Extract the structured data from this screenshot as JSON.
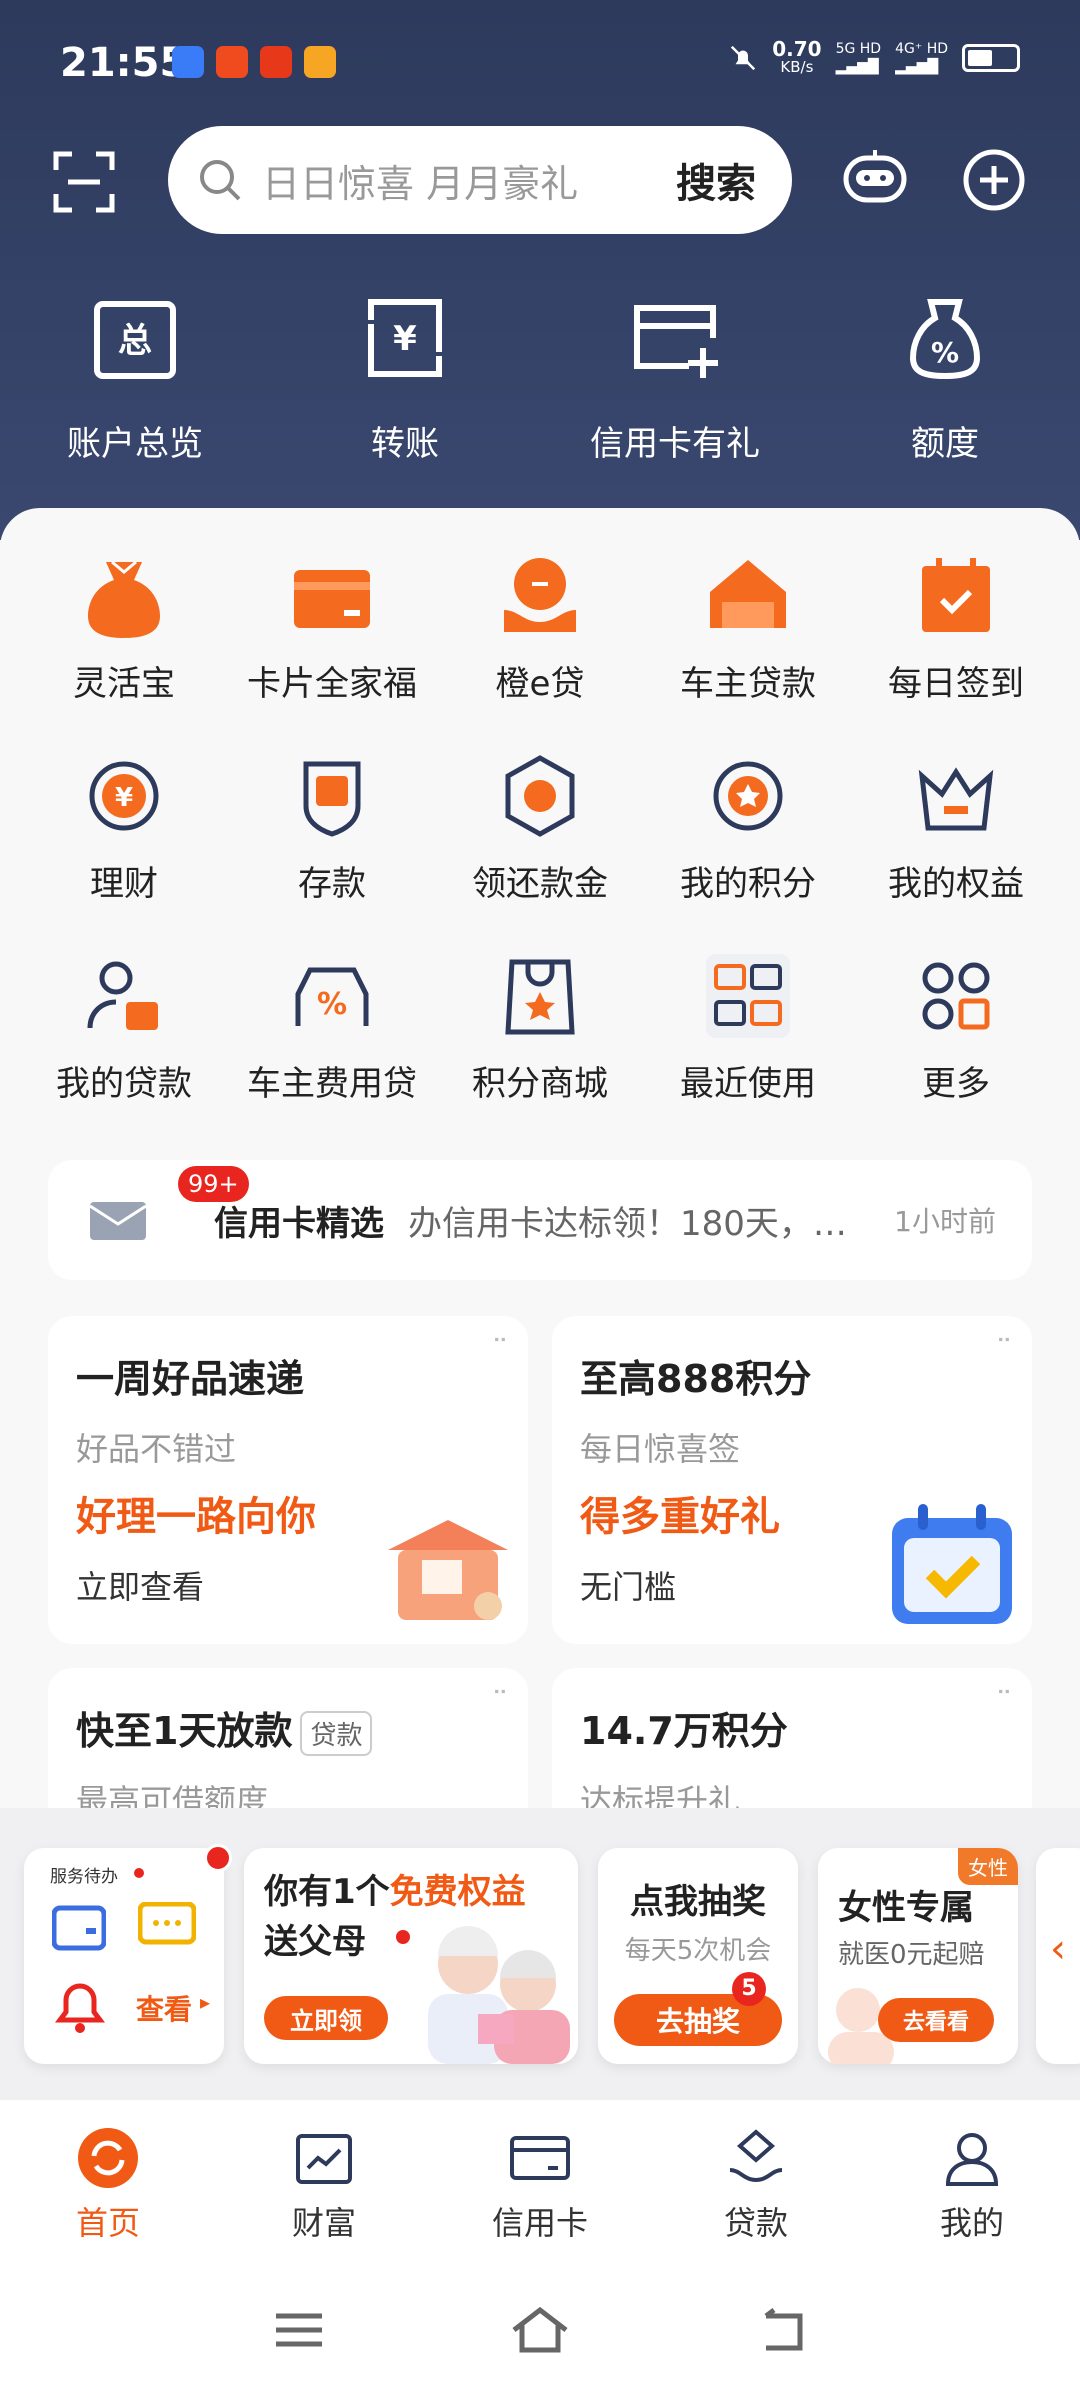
{
  "status_bar": {
    "time": "21:55",
    "net_speed": "0.70",
    "net_unit": "KB/s",
    "sig1": "5G HD",
    "sig2": "4G⁺ HD"
  },
  "search": {
    "placeholder": "日日惊喜 月月豪礼",
    "button": "搜索"
  },
  "top_nav": [
    {
      "label": "账户总览",
      "icon": "account-overview-icon"
    },
    {
      "label": "转账",
      "icon": "transfer-icon"
    },
    {
      "label": "信用卡有礼",
      "icon": "credit-card-gift-icon"
    },
    {
      "label": "额度",
      "icon": "quota-icon"
    }
  ],
  "grid": [
    {
      "label": "灵活宝",
      "icon": "moneybag-icon"
    },
    {
      "label": "卡片全家福",
      "icon": "card-icon"
    },
    {
      "label": "橙e贷",
      "icon": "loan-hand-icon"
    },
    {
      "label": "车主贷款",
      "icon": "car-house-icon"
    },
    {
      "label": "每日签到",
      "icon": "calendar-check-icon"
    },
    {
      "label": "理财",
      "icon": "yuan-circle-icon"
    },
    {
      "label": "存款",
      "icon": "deposit-shield-icon"
    },
    {
      "label": "领还款金",
      "icon": "repay-hexagon-icon"
    },
    {
      "label": "我的积分",
      "icon": "star-circle-icon"
    },
    {
      "label": "我的权益",
      "icon": "crown-icon"
    },
    {
      "label": "我的贷款",
      "icon": "user-loan-icon"
    },
    {
      "label": "车主费用贷",
      "icon": "car-percent-icon"
    },
    {
      "label": "积分商城",
      "icon": "shopping-bag-star-icon"
    },
    {
      "label": "最近使用",
      "icon": "recent-apps-icon"
    },
    {
      "label": "更多",
      "icon": "more-grid-icon"
    }
  ],
  "notice": {
    "badge": "99+",
    "title": "信用卡精选",
    "text": "办信用卡达标领！180天，…",
    "time": "1小时前"
  },
  "promo_cards": [
    {
      "title": "一周好品速递",
      "subtitle": "好品不错过",
      "highlight": "好理一路向你",
      "cta": "立即查看"
    },
    {
      "title": "至高888积分",
      "subtitle": "每日惊喜签",
      "highlight": "得多重好礼",
      "cta": "无门槛"
    },
    {
      "title": "快至1天放款",
      "tag": "贷款",
      "subtitle": "最高可借额度"
    },
    {
      "title": "14.7万积分",
      "subtitle": "达标提升礼"
    }
  ],
  "strip": {
    "service_label": "服务待办",
    "service_view": "查看",
    "benefit_line1a": "你有1个",
    "benefit_line1b": "免费权益",
    "benefit_line2": "送父母",
    "benefit_btn": "立即领",
    "lottery_title": "点我抽奖",
    "lottery_sub": "每天5次机会",
    "lottery_btn": "去抽奖",
    "lottery_badge": "5",
    "women_tag": "女性",
    "women_title": "女性专属",
    "women_sub": "就医0元起赔",
    "women_btn": "去看看"
  },
  "tabs": [
    {
      "label": "首页",
      "icon": "home-icon",
      "active": true
    },
    {
      "label": "财富",
      "icon": "wealth-icon"
    },
    {
      "label": "信用卡",
      "icon": "credit-card-icon"
    },
    {
      "label": "贷款",
      "icon": "loan-icon"
    },
    {
      "label": "我的",
      "icon": "profile-icon"
    }
  ],
  "colors": {
    "accent": "#f05a14",
    "header": "#2d3a5c"
  }
}
